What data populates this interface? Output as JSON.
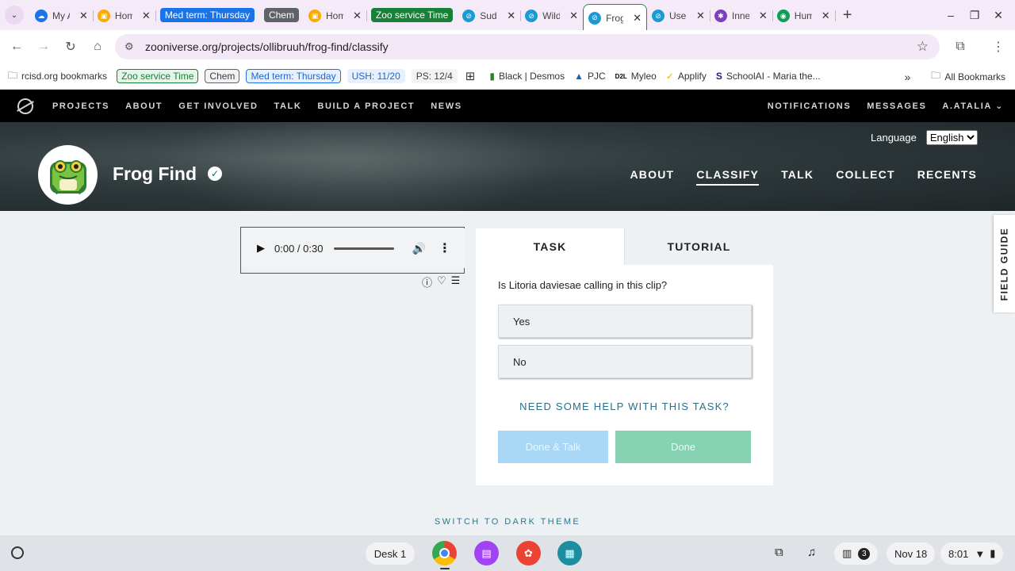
{
  "browser": {
    "tabs": [
      {
        "label": "My A",
        "favicon_color": "#1a73e8",
        "favicon_glyph": "☁"
      },
      {
        "label": "Hom",
        "favicon_color": "#f9ab00",
        "favicon_glyph": "▣"
      },
      {
        "group": "Med term: Thursday",
        "group_color": "#1a73e8"
      },
      {
        "group": "Chem",
        "group_color": "#5f6368"
      },
      {
        "label": "Hom",
        "favicon_color": "#f9ab00",
        "favicon_glyph": "▣"
      },
      {
        "group": "Zoo service Time",
        "group_color": "#188038"
      },
      {
        "label": "Sud",
        "favicon_color": "#1d9ad6",
        "favicon_glyph": "⊘"
      },
      {
        "label": "Wild",
        "favicon_color": "#1d9ad6",
        "favicon_glyph": "⊘"
      },
      {
        "label": "Frog",
        "favicon_color": "#1d9ad6",
        "favicon_glyph": "⊘",
        "active": true
      },
      {
        "label": "User",
        "favicon_color": "#1d9ad6",
        "favicon_glyph": "⊘"
      },
      {
        "label": "Inne",
        "favicon_color": "#7b3fbf",
        "favicon_glyph": "✱"
      },
      {
        "label": "Hum",
        "favicon_color": "#0f9d58",
        "favicon_glyph": "◉"
      }
    ],
    "url": "zooniverse.org/projects/ollibruuh/frog-find/classify",
    "bookmarks": {
      "folder": "rcisd.org bookmarks",
      "chips": [
        {
          "label": "Zoo service Time",
          "color": "#188038",
          "bg": "#e6f4ea",
          "border": "#188038"
        },
        {
          "label": "Chem",
          "color": "#3c4043",
          "bg": "#f1f3f4",
          "border": "#5f6368"
        },
        {
          "label": "Med term: Thursday",
          "color": "#1967d2",
          "bg": "#e8f0fe",
          "border": "#1a73e8"
        },
        {
          "label": "USH: 11/20",
          "color": "#1967d2",
          "bg": "#e8f0fe",
          "border": "#e8f0fe"
        },
        {
          "label": "PS: 12/4",
          "color": "#3c4043",
          "bg": "#f1f3f4",
          "border": "#f1f3f4"
        }
      ],
      "links": [
        {
          "label": "Black | Desmos",
          "icon": "▮",
          "icon_color": "#2e7d32"
        },
        {
          "label": "PJC",
          "icon": "▲",
          "icon_color": "#1565c0"
        },
        {
          "label": "Myleo",
          "icon": "D2L",
          "icon_color": "#000000"
        },
        {
          "label": "Applify",
          "icon": "✓",
          "icon_color": "#f9ab00"
        },
        {
          "label": "SchoolAI - Maria the...",
          "icon": "S",
          "icon_color": "#1a237e"
        }
      ],
      "all_bookmarks": "All Bookmarks"
    }
  },
  "zoo_nav": {
    "left": [
      "PROJECTS",
      "ABOUT",
      "GET INVOLVED",
      "TALK",
      "BUILD A PROJECT",
      "NEWS"
    ],
    "notifications": "NOTIFICATIONS",
    "messages": "MESSAGES",
    "user": "A.ATALIA"
  },
  "project": {
    "language_label": "Language",
    "language_value": "English",
    "title": "Frog Find",
    "nav": [
      {
        "label": "ABOUT"
      },
      {
        "label": "CLASSIFY",
        "active": true
      },
      {
        "label": "TALK"
      },
      {
        "label": "COLLECT"
      },
      {
        "label": "RECENTS"
      }
    ]
  },
  "audio": {
    "time": "0:00 / 0:30"
  },
  "task": {
    "tab_task": "TASK",
    "tab_tutorial": "TUTORIAL",
    "question": "Is Litoria daviesae calling in this clip?",
    "answers": [
      "Yes",
      "No"
    ],
    "help": "NEED SOME HELP WITH THIS TASK?",
    "done_talk": "Done & Talk",
    "done": "Done"
  },
  "field_guide": "FIELD GUIDE",
  "dark_theme": "SWITCH TO DARK THEME",
  "shelf": {
    "desk": "Desk 1",
    "notification_count": "3",
    "date": "Nov 18",
    "time": "8:01"
  }
}
